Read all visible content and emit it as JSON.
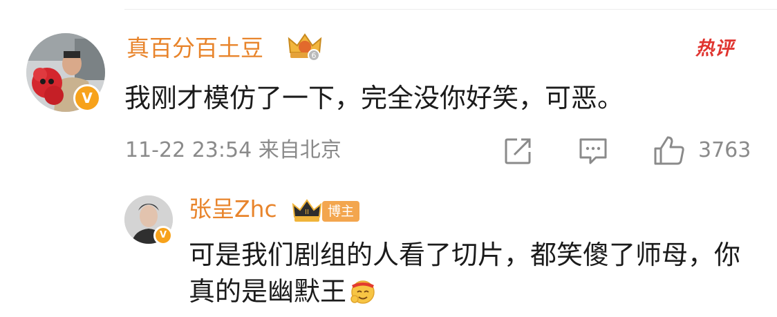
{
  "comment": {
    "username": "真百分百土豆",
    "level_badge": "6",
    "verified_badge": "V",
    "hot_tag": "热评",
    "text": "我刚才模仿了一下，完全没你好笑，可恶。",
    "timestamp": "11-22 23:54 来自北京",
    "like_count": "3763",
    "icons": {
      "share": "share-icon",
      "comment": "comment-icon",
      "like": "thumbs-up-icon"
    }
  },
  "reply": {
    "username": "张呈Zhc",
    "level_badge": "II",
    "role_tag": "博主",
    "verified_badge": "V",
    "text": "可是我们剧组的人看了切片，都笑傻了师母，你真的是幽默王",
    "emoji": "salute-emoji"
  },
  "colors": {
    "username": "#e8842b",
    "hot_tag": "#e0342f",
    "verified": "#f7a21b",
    "meta_text": "#8a8a8a",
    "body_text": "#1b1b1b",
    "blogger_tag": "#f3a64e"
  }
}
